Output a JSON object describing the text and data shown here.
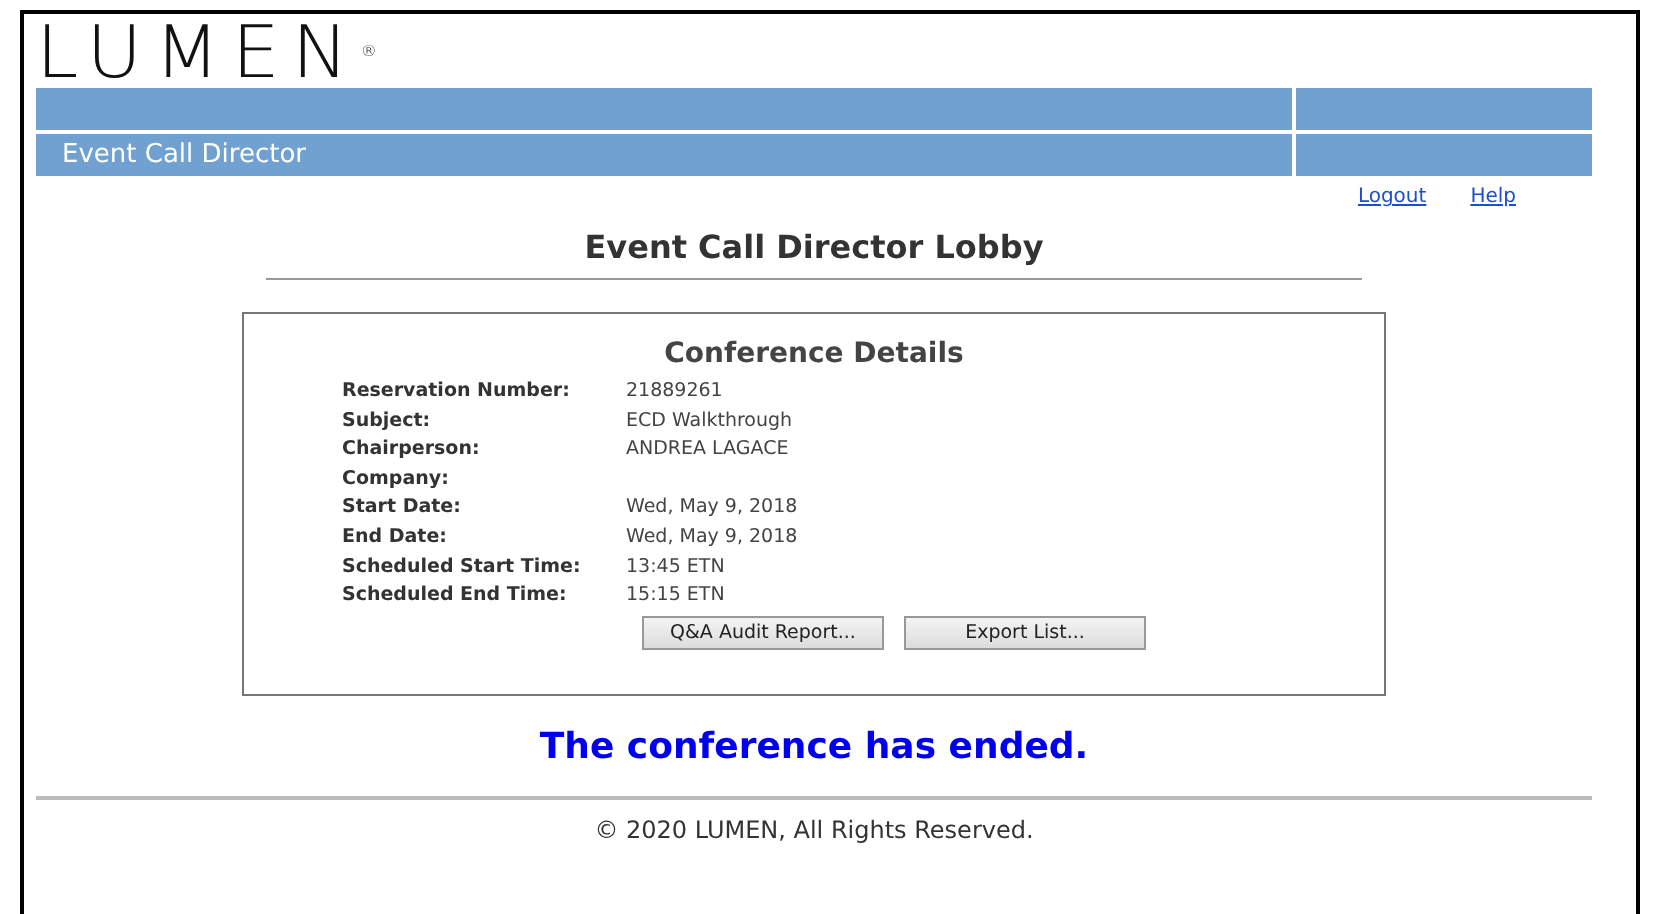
{
  "logo": {
    "text": "LUMEN",
    "mark": "®"
  },
  "header": {
    "title": "Event Call Director"
  },
  "links": [
    "Logout",
    "Help"
  ],
  "page_title": "Event Call Director Lobby",
  "details": {
    "title": "Conference Details",
    "fields": [
      {
        "label": "Reservation Number:",
        "value": "21889261"
      },
      {
        "label": "Subject:",
        "value": "ECD Walkthrough"
      },
      {
        "label": "Chairperson:",
        "value": "ANDREA LAGACE"
      },
      {
        "label": "Company:"
      },
      {
        "label": "Start Date:",
        "value": "Wed, May 9, 2018"
      },
      {
        "label": "End Date:",
        "value": "Wed, May 9, 2018"
      },
      {
        "label": "Scheduled Start Time:",
        "value": "13:45 ETN"
      },
      {
        "label": "Scheduled End Time:",
        "value": "15:15 ETN"
      }
    ],
    "buttons": [
      "Q&A Audit Report...",
      "Export List..."
    ]
  },
  "status_message": "The conference has ended.",
  "footer": "© 2020 LUMEN, All Rights Reserved."
}
